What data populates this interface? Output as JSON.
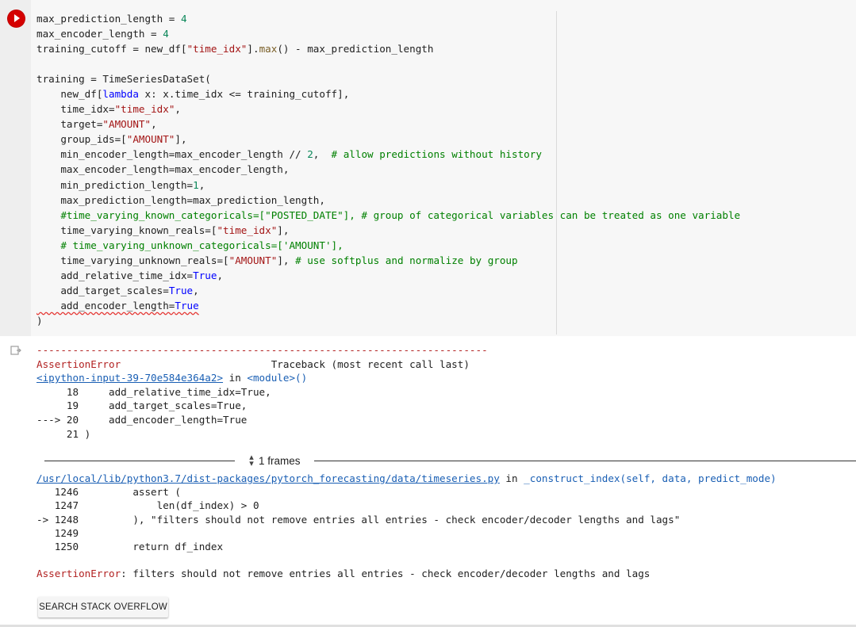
{
  "cell": {
    "code_lines": [
      [
        {
          "t": "max_prediction_length = "
        },
        {
          "t": "4",
          "c": "num"
        }
      ],
      [
        {
          "t": "max_encoder_length = "
        },
        {
          "t": "4",
          "c": "num"
        }
      ],
      [
        {
          "t": "training_cutoff = new_df["
        },
        {
          "t": "\"time_idx\"",
          "c": "str"
        },
        {
          "t": "]."
        },
        {
          "t": "max",
          "c": "fn"
        },
        {
          "t": "() - max_prediction_length"
        }
      ],
      [
        {
          "t": ""
        }
      ],
      [
        {
          "t": "training = TimeSeriesDataSet("
        }
      ],
      [
        {
          "t": "    new_df["
        },
        {
          "t": "lambda",
          "c": "kw"
        },
        {
          "t": " x: x.time_idx <= training_cutoff],"
        }
      ],
      [
        {
          "t": "    time_idx="
        },
        {
          "t": "\"time_idx\"",
          "c": "str"
        },
        {
          "t": ","
        }
      ],
      [
        {
          "t": "    target="
        },
        {
          "t": "\"AMOUNT\"",
          "c": "str"
        },
        {
          "t": ","
        }
      ],
      [
        {
          "t": "    group_ids=["
        },
        {
          "t": "\"AMOUNT\"",
          "c": "str"
        },
        {
          "t": "],"
        }
      ],
      [
        {
          "t": "    min_encoder_length=max_encoder_length // "
        },
        {
          "t": "2",
          "c": "num"
        },
        {
          "t": ",  "
        },
        {
          "t": "# allow predictions without history",
          "c": "com"
        }
      ],
      [
        {
          "t": "    max_encoder_length=max_encoder_length,"
        }
      ],
      [
        {
          "t": "    min_prediction_length="
        },
        {
          "t": "1",
          "c": "num"
        },
        {
          "t": ","
        }
      ],
      [
        {
          "t": "    max_prediction_length=max_prediction_length,"
        }
      ],
      [
        {
          "t": "    #time_varying_known_categoricals=[\"POSTED_DATE\"], # group of categorical variables can be treated as one variable",
          "c": "com"
        }
      ],
      [
        {
          "t": "    time_varying_known_reals=["
        },
        {
          "t": "\"time_idx\"",
          "c": "str"
        },
        {
          "t": "],"
        }
      ],
      [
        {
          "t": "    # time_varying_unknown_categoricals=['AMOUNT'],",
          "c": "com"
        }
      ],
      [
        {
          "t": "    time_varying_unknown_reals=["
        },
        {
          "t": "\"AMOUNT\"",
          "c": "str"
        },
        {
          "t": "], "
        },
        {
          "t": "# use softplus and normalize by group",
          "c": "com"
        }
      ],
      [
        {
          "t": "    add_relative_time_idx="
        },
        {
          "t": "True",
          "c": "kw"
        },
        {
          "t": ","
        }
      ],
      [
        {
          "t": "    add_target_scales="
        },
        {
          "t": "True",
          "c": "kw"
        },
        {
          "t": ","
        }
      ],
      [
        {
          "t": "    add_encoder_length=",
          "c": "sq"
        },
        {
          "t": "True",
          "c": "kwsq"
        }
      ],
      [
        {
          "t": ")"
        }
      ]
    ]
  },
  "output": {
    "dashes": "---------------------------------------------------------------------------",
    "error_name": "AssertionError",
    "traceback_header": "                         Traceback (most recent call last)",
    "input_link": "<ipython-input-39-70e584e364a2>",
    "in_word": " in ",
    "module": "<module>()",
    "trace_lines": [
      "     18     add_relative_time_idx=True,",
      "     19     add_target_scales=True,",
      "---> 20     add_encoder_length=True",
      "     21 )"
    ],
    "frames_label": "1 frames",
    "file_link": "/usr/local/lib/python3.7/dist-packages/pytorch_forecasting/data/timeseries.py",
    "file_in": " in ",
    "func_sig": "_construct_index(self, data, predict_mode)",
    "frame_lines": [
      "   1246         assert (",
      "   1247             len(df_index) > 0",
      "-> 1248         ), \"filters should not remove entries all entries - check encoder/decoder lengths and lags\"",
      "   1249 ",
      "   1250         return df_index"
    ],
    "final_error_name": "AssertionError",
    "final_error_msg": ": filters should not remove entries all entries - check encoder/decoder lengths and lags",
    "search_button": "SEARCH STACK OVERFLOW"
  }
}
